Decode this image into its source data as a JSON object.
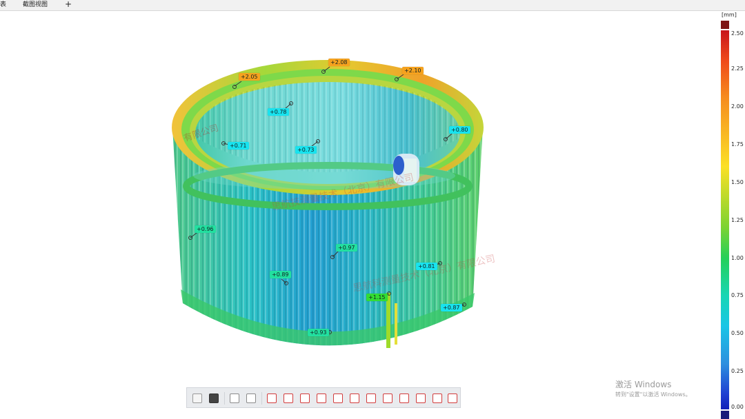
{
  "tabs": {
    "tab1": "表",
    "tab2": "截图视图",
    "add": "+"
  },
  "legend": {
    "unit": "[mm]",
    "ticks": [
      "2.50",
      "2.25",
      "2.00",
      "1.75",
      "1.50",
      "1.25",
      "1.00",
      "0.75",
      "0.50",
      "0.25",
      "0.00"
    ]
  },
  "labels": [
    {
      "text": "+2.05",
      "color": "#f6a21e"
    },
    {
      "text": "+2.08",
      "color": "#f6a21e"
    },
    {
      "text": "+2.10",
      "color": "#f6a21e"
    },
    {
      "text": "+0.78",
      "color": "#18e3ef"
    },
    {
      "text": "+0.80",
      "color": "#18e3ef"
    },
    {
      "text": "+0.71",
      "color": "#18e3ef"
    },
    {
      "text": "+0.73",
      "color": "#18e3ef"
    },
    {
      "text": "+0.96",
      "color": "#22e0a0"
    },
    {
      "text": "+0.97",
      "color": "#22e0a0"
    },
    {
      "text": "+0.81",
      "color": "#18e3ef"
    },
    {
      "text": "+0.89",
      "color": "#22e0a0"
    },
    {
      "text": "+1.15",
      "color": "#33dd33"
    },
    {
      "text": "+0.87",
      "color": "#18e3ef"
    },
    {
      "text": "+0.93",
      "color": "#22e0a0"
    }
  ],
  "watermarks": [
    "有限公司",
    "思航技测量技术（北京）有限公司",
    "思航科测量技术（北京）有限公司"
  ],
  "activation": {
    "title": "激活 Windows",
    "subtitle": "转到\"设置\"以激活 Windows。"
  },
  "toolbar": {
    "icons": [
      "view-icon",
      "monitor-icon",
      "select-icon",
      "split-icon",
      "section-icon",
      "cross-section-icon",
      "probe-icon",
      "square-icon",
      "chart-icon",
      "angle-icon",
      "link-icon",
      "grid-icon",
      "expand-icon",
      "check-icon",
      "close-icon",
      "report-icon"
    ]
  }
}
